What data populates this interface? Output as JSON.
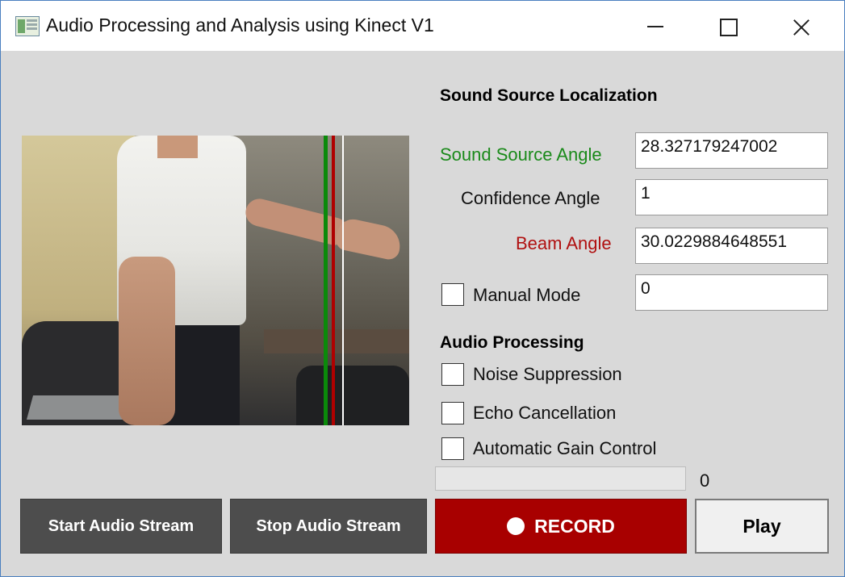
{
  "window": {
    "title": "Audio Processing and Analysis using Kinect V1"
  },
  "localization": {
    "heading": "Sound Source Localization",
    "sound_source_angle_label": "Sound Source Angle",
    "sound_source_angle_value": "28.327179247002",
    "confidence_angle_label": "Confidence Angle",
    "confidence_angle_value": "1",
    "beam_angle_label": "Beam Angle",
    "beam_angle_value": "30.0229884648551",
    "manual_mode_label": "Manual Mode",
    "manual_mode_checked": false,
    "manual_mode_value": "0"
  },
  "processing": {
    "heading": "Audio Processing",
    "options": [
      {
        "label": "Noise Suppression",
        "checked": false
      },
      {
        "label": "Echo Cancellation",
        "checked": false
      },
      {
        "label": "Automatic Gain Control",
        "checked": false
      }
    ]
  },
  "level": {
    "value": "0",
    "fraction": 0
  },
  "buttons": {
    "start": "Start Audio Stream",
    "stop": "Stop Audio Stream",
    "record": "RECORD",
    "play": "Play"
  },
  "colors": {
    "sound_source": "#0a8a0a",
    "beam": "#b00000",
    "record_bg": "#a80000"
  },
  "icons": {
    "app": "app-icon",
    "minimize": "minimize-icon",
    "maximize": "maximize-icon",
    "close": "close-icon",
    "record": "record-dot-icon"
  }
}
